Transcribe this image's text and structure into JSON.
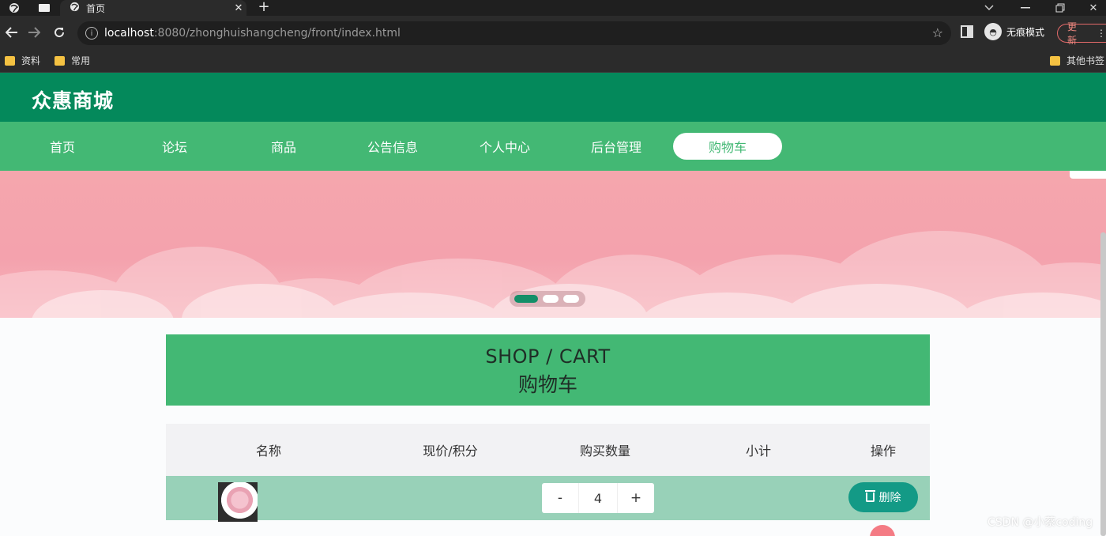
{
  "browser": {
    "tab_title": "首页",
    "url_host": "localhost",
    "url_path": ":8080/zhonghuishangcheng/front/index.html",
    "incognito_label": "无痕模式",
    "update_label": "更新",
    "bookmarks": [
      "资料",
      "常用"
    ],
    "other_bookmarks": "其他书签"
  },
  "site": {
    "title": "众惠商城",
    "nav": [
      "首页",
      "论坛",
      "商品",
      "公告信息",
      "个人中心",
      "后台管理",
      "购物车"
    ],
    "active_nav": "购物车",
    "accent": "#43b874",
    "header_color": "#04895b"
  },
  "banner": {
    "slide_count": 3,
    "active_slide": 1
  },
  "cart": {
    "heading_en": "SHOP / CART",
    "heading_cn": "购物车",
    "columns": [
      "名称",
      "现价/积分",
      "购买数量",
      "小计",
      "操作"
    ],
    "rows": [
      {
        "quantity": "4",
        "decrement": "-",
        "increment": "+",
        "delete_label": "删除"
      }
    ]
  },
  "watermark": "CSDN @小蔡coding"
}
